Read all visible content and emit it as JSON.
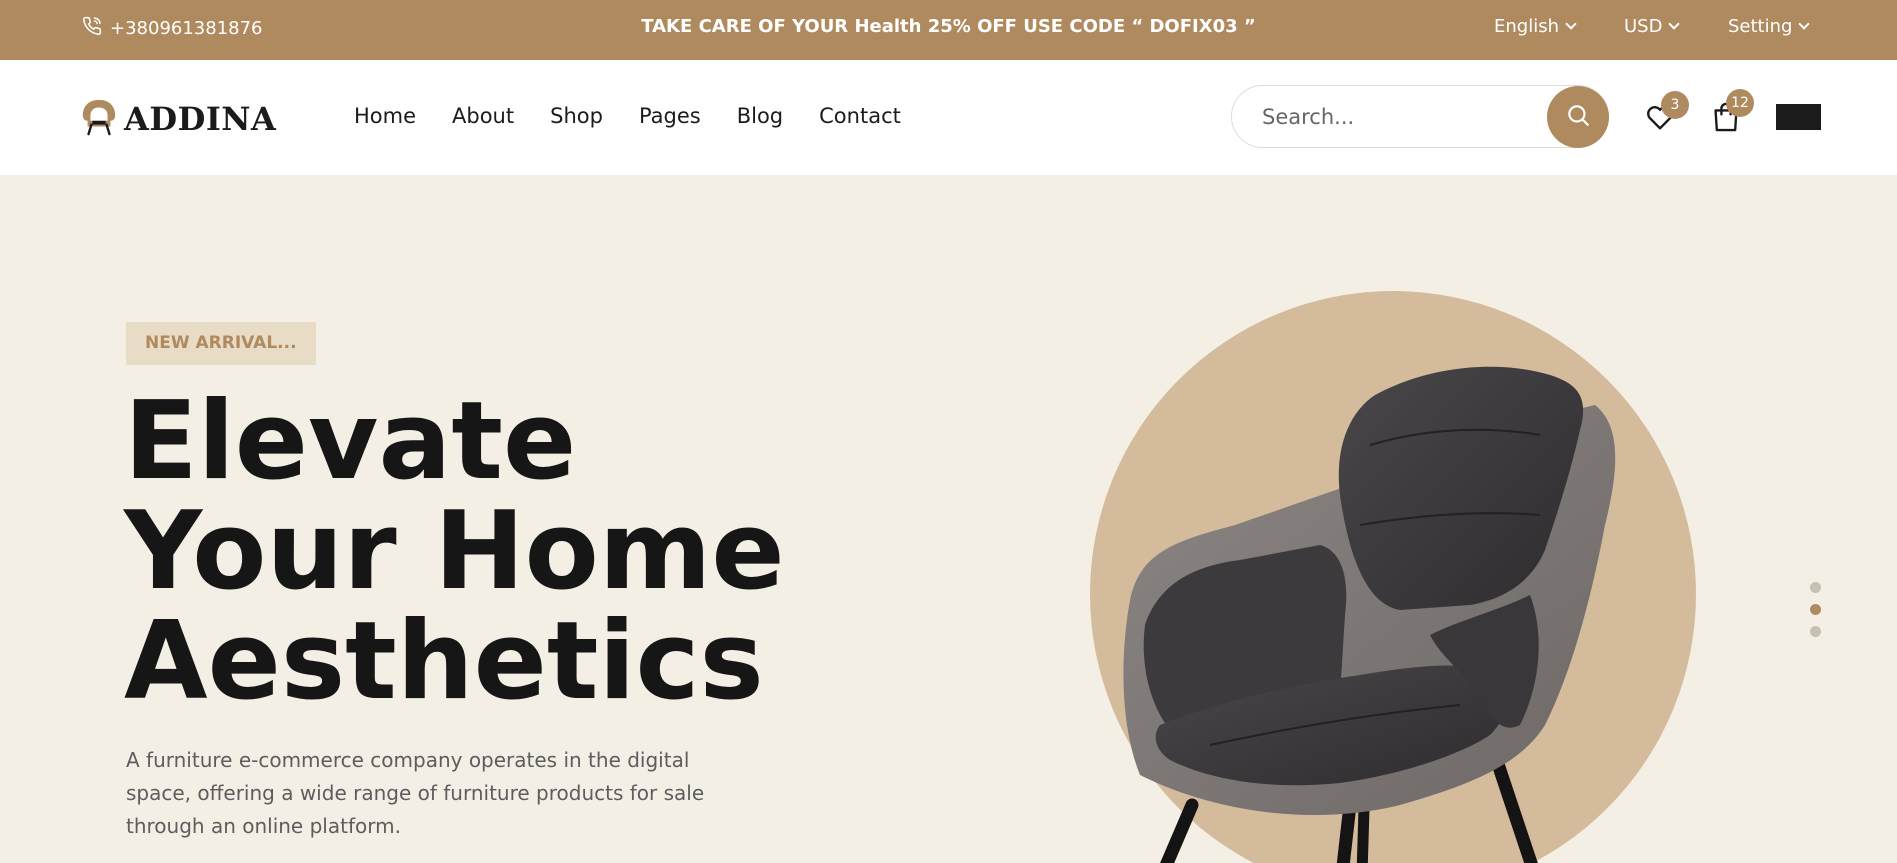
{
  "topbar": {
    "phone": "+380961381876",
    "promo": "TAKE CARE OF YOUR Health 25% OFF USE CODE “ DOFIX03 ”",
    "language": "English",
    "currency": "USD",
    "setting": "Setting",
    "background_color": "#b08a5f"
  },
  "header": {
    "logo_text": "ADDINA",
    "nav": [
      "Home",
      "About",
      "Shop",
      "Pages",
      "Blog",
      "Contact"
    ],
    "search_placeholder": "Search...",
    "wishlist_count": "3",
    "cart_count": "12",
    "icons": [
      "search-icon",
      "heart-icon",
      "shopping-bag-icon",
      "hamburger-menu-icon",
      "phone-icon",
      "chevron-down-icon"
    ]
  },
  "hero": {
    "tag": "NEW ARRIVAL...",
    "headline": [
      "Elevate",
      "Your Home",
      "Aesthetics"
    ],
    "description": "A furniture e-commerce company operates in the digital space, offering a wide range of furniture products for sale through an online platform.",
    "slider_dots": 3,
    "active_slide": 2,
    "accent_color": "#b08a5f",
    "circle_color": "#d4bb9c",
    "background_color": "#f4efe5"
  }
}
